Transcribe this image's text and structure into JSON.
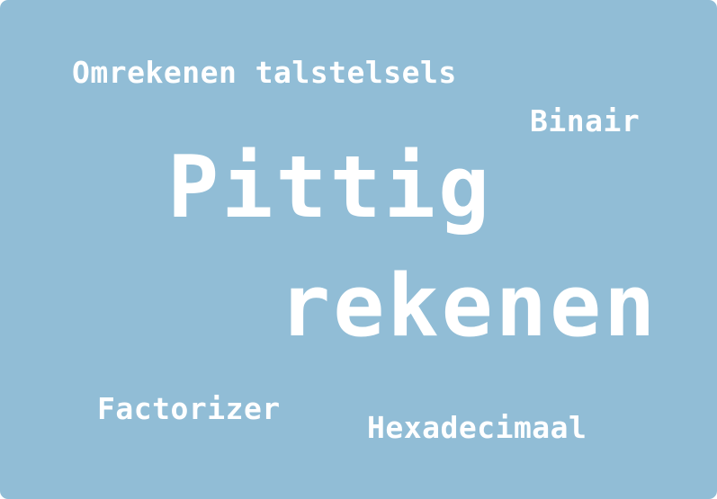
{
  "tile": {
    "background_color": "#91bdd6",
    "text_color": "#ffffff",
    "title_line_1": "Pittig",
    "title_line_2": "rekenen",
    "tags": {
      "omrekenen": "Omrekenen talstelsels",
      "binair": "Binair",
      "factorizer": "Factorizer",
      "hexadecimaal": "Hexadecimaal"
    }
  }
}
